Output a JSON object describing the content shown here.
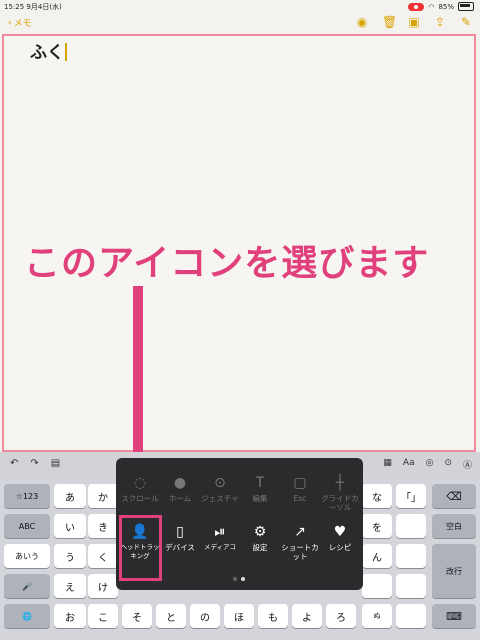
{
  "status": {
    "time": "15:25",
    "date": "9月4日(水)",
    "battery": "85%"
  },
  "nav": {
    "back_label": "メモ"
  },
  "note": {
    "text": "ふく"
  },
  "annotation": {
    "headline": "このアイコンを選びます",
    "color": "#e0407b"
  },
  "keyboard": {
    "left_keys": [
      "☆123",
      "ABC",
      "あいう",
      "🎤",
      "🌐"
    ],
    "cols": [
      [
        "あ",
        "い",
        "う",
        "え",
        "お"
      ],
      [
        "か",
        "き",
        "く",
        "け",
        "こ"
      ],
      [
        "",
        "",
        "",
        "",
        "そ"
      ],
      [
        "",
        "",
        "",
        "",
        "と"
      ],
      [
        "",
        "",
        "",
        "",
        "の"
      ],
      [
        "",
        "",
        "",
        "",
        "ほ"
      ],
      [
        "",
        "",
        "",
        "",
        "も"
      ],
      [
        "",
        "",
        "",
        "",
        "よ"
      ],
      [
        "",
        "",
        "",
        "",
        "ろ"
      ],
      [
        "な",
        "を",
        "ん",
        "",
        "ぬ"
      ],
      [
        "「」",
        "",
        "",
        "",
        ""
      ]
    ],
    "right_keys": [
      "⌫",
      "空白",
      "改行",
      "⌨"
    ]
  },
  "popup": {
    "row1": [
      "スクロール",
      "ホーム",
      "ジェスチャ",
      "編集",
      "Esc",
      "グライドカーソル"
    ],
    "row2": [
      "ヘッドトラッキング",
      "デバイス",
      "メディアコ",
      "設定",
      "ショートカット",
      "レシピ"
    ]
  },
  "toolbar": {
    "text_format": "Aa"
  }
}
